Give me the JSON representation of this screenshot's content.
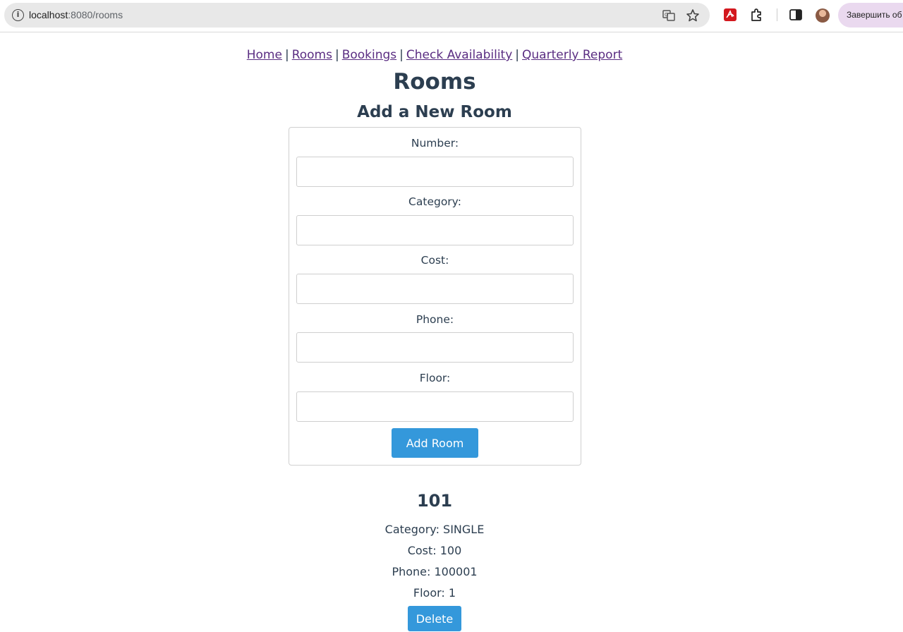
{
  "browser": {
    "url_host": "localhost",
    "url_path": ":8080/rooms",
    "finish_button": "Завершить об"
  },
  "nav": {
    "links": [
      "Home",
      "Rooms",
      "Bookings",
      "Check Availability",
      "Quarterly Report"
    ],
    "separator": "|"
  },
  "page": {
    "title": "Rooms",
    "section_title": "Add a New Room"
  },
  "form": {
    "fields": [
      {
        "label": "Number:",
        "value": ""
      },
      {
        "label": "Category:",
        "value": ""
      },
      {
        "label": "Cost:",
        "value": ""
      },
      {
        "label": "Phone:",
        "value": ""
      },
      {
        "label": "Floor:",
        "value": ""
      }
    ],
    "submit_label": "Add Room"
  },
  "rooms": [
    {
      "number": "101",
      "category": "Category: SINGLE",
      "cost": "Cost: 100",
      "phone": "Phone: 100001",
      "floor": "Floor: 1",
      "delete_label": "Delete"
    }
  ],
  "colors": {
    "accent": "#3498db",
    "text": "#2c3e50",
    "link": "#5a2d82"
  }
}
